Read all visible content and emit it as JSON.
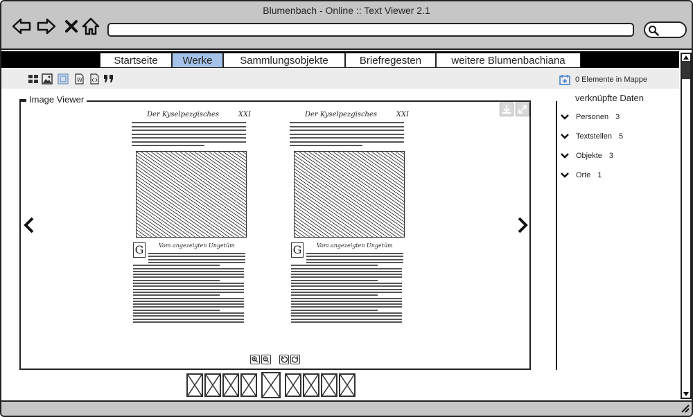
{
  "window": {
    "title": "Blumenbach - Online :: Text Viewer 2.1"
  },
  "nav": {
    "back_icon": "back-arrow-icon",
    "forward_icon": "forward-arrow-icon",
    "close_icon": "close-icon",
    "home_icon": "home-icon",
    "search_icon": "search-icon",
    "url_value": ""
  },
  "menu": {
    "tabs": [
      {
        "label": "Startseite",
        "active": false
      },
      {
        "label": "Werke",
        "active": true
      },
      {
        "label": "Sammlungsobjekte",
        "active": false
      },
      {
        "label": "Briefregesten",
        "active": false
      },
      {
        "label": "weitere Blumenbachiana",
        "active": false
      }
    ]
  },
  "toolbar": {
    "icons": [
      "grid-view-icon",
      "image-icon",
      "fullscreen-icon",
      "word-doc-icon",
      "code-icon",
      "quote-icon"
    ],
    "mappe_label": "0 Elemente in Mappe"
  },
  "viewer": {
    "title": "Image Viewer",
    "page_left": {
      "header_left": "Der Kyselpezgisches",
      "header_right": "XXI"
    },
    "page_right": {
      "header_left": "Der Kyselpezgisches",
      "header_right": "XXI"
    },
    "subhead_text": "Vom angezeigten Ungetüm",
    "dropcap": "G",
    "controls": [
      "zoom-in-icon",
      "zoom-out-icon",
      "rotate-left-icon",
      "rotate-right-icon"
    ],
    "thumbnail_count": 9,
    "active_thumbnail": 5
  },
  "sidepanel": {
    "title": "verknüpfte Daten",
    "items": [
      {
        "label": "Personen",
        "count": "3"
      },
      {
        "label": "Textstellen",
        "count": "5"
      },
      {
        "label": "Objekte",
        "count": "3"
      },
      {
        "label": "Orte",
        "count": "1"
      }
    ]
  },
  "colors": {
    "active_tab": "#a5c1e9",
    "menubar": "#000000",
    "titlebar": "#c6c6c6"
  }
}
